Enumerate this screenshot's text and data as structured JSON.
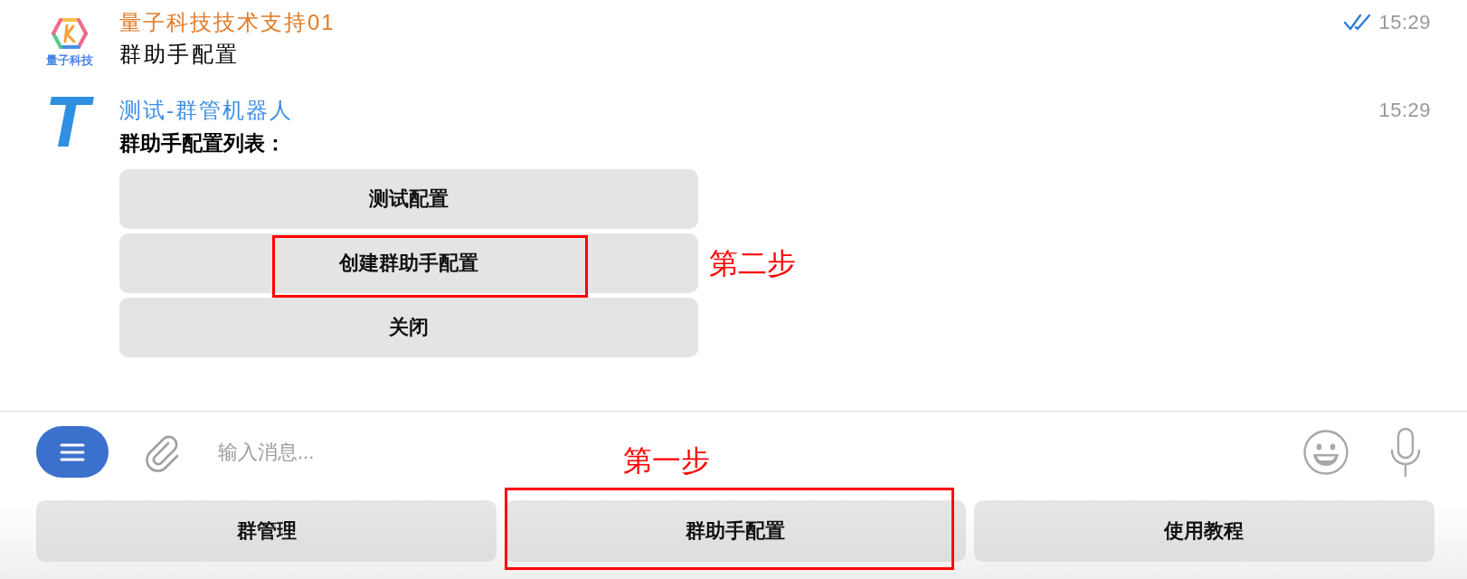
{
  "messages": [
    {
      "kind": "user",
      "sender": "量子科技技术支持01",
      "color": "#e07b27",
      "avatar": {
        "kind": "logo",
        "caption": "量子科技"
      },
      "text": "群助手配置",
      "time": "15:29",
      "read": true
    },
    {
      "kind": "bot",
      "sender": "测试-群管机器人",
      "color": "#3b8ee4",
      "avatar": {
        "kind": "letter",
        "letter": "T"
      },
      "text": "群助手配置列表：",
      "time": "15:29",
      "read": false,
      "inline_keyboard": [
        {
          "label": "测试配置"
        },
        {
          "label": "创建群助手配置",
          "annotation": "第二步"
        },
        {
          "label": "关闭"
        }
      ]
    }
  ],
  "composer": {
    "placeholder": "输入消息..."
  },
  "reply_keyboard": [
    {
      "label": "群管理"
    },
    {
      "label": "群助手配置",
      "annotation": "第一步"
    },
    {
      "label": "使用教程"
    }
  ]
}
